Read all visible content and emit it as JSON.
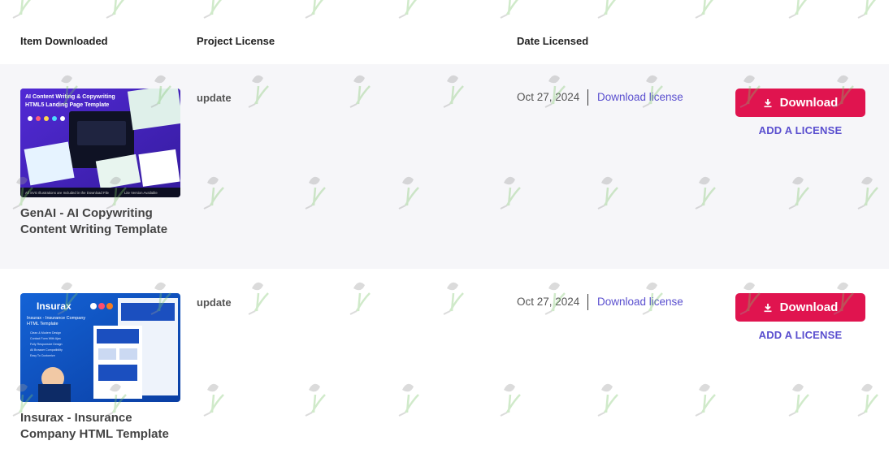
{
  "table": {
    "headers": {
      "item": "Item Downloaded",
      "project": "Project License",
      "date": "Date Licensed"
    },
    "rows": [
      {
        "thumb": {
          "title_line1": "AI Content Writing & Copywriting",
          "title_line2": "HTML5 Landing Page Template",
          "footer_left": "All SVG Illustrations are Included in the Download File",
          "footer_right": "Lite Version Available"
        },
        "title": "GenAI - AI Copywriting Content Writing Template",
        "project_license": "update",
        "date": "Oct 27, 2024",
        "download_license": "Download license",
        "download_button": "Download",
        "add_license": "ADD A LICENSE"
      },
      {
        "thumb": {
          "brand": "Insurax",
          "title_line1": "Insurax - Insurance Company",
          "title_line2": "HTML Template",
          "features": [
            "Clean & Modern Design",
            "Contact Form With Ajax",
            "Fully Responsive Design",
            "All Browser Compatibility",
            "Easy To Customize"
          ]
        },
        "title": "Insurax - Insurance Company HTML Template",
        "project_license": "update",
        "date": "Oct 27, 2024",
        "download_license": "Download license",
        "download_button": "Download",
        "add_license": "ADD A LICENSE"
      }
    ]
  },
  "colors": {
    "accent": "#e0144f",
    "link": "#5a4fcf",
    "row_bg_alt": "#f6f6f9"
  }
}
